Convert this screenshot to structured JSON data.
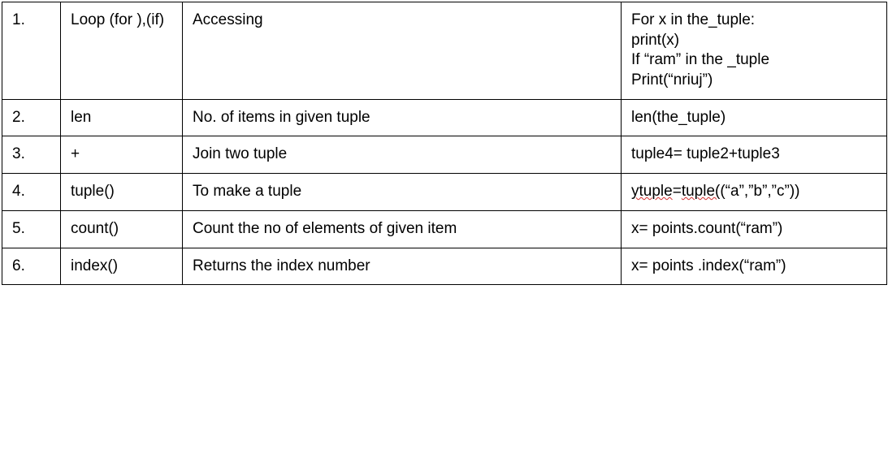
{
  "rows": [
    {
      "num": "1.",
      "name": "Loop (for ),(if)",
      "desc": "Accessing",
      "example_a": "For x in the_tuple:\n  print(x)\nIf “ram” in the _tuple\nPrint(“nriuj”)"
    },
    {
      "num": "2.",
      "name": "len",
      "desc": "No. of items in given tuple",
      "example_a": "len(the_tuple)"
    },
    {
      "num": "3.",
      "name": "+",
      "desc": "Join two tuple",
      "example_a": "tuple4= tuple2+tuple3"
    },
    {
      "num": "4.",
      "name": "tuple()",
      "desc": "To make a tuple",
      "example_err1": "ytuple",
      "example_mid": "=",
      "example_err2": "tuple(",
      "example_tail": "(“a”,”b”,”c”))"
    },
    {
      "num": "5.",
      "name": "count()",
      "desc": "Count the no of elements of given item",
      "example_a": "x= points.count(“ram”)"
    },
    {
      "num": "6.",
      "name": "index()",
      "desc": "Returns the index number",
      "example_a": "x= points .index(“ram”)"
    }
  ]
}
